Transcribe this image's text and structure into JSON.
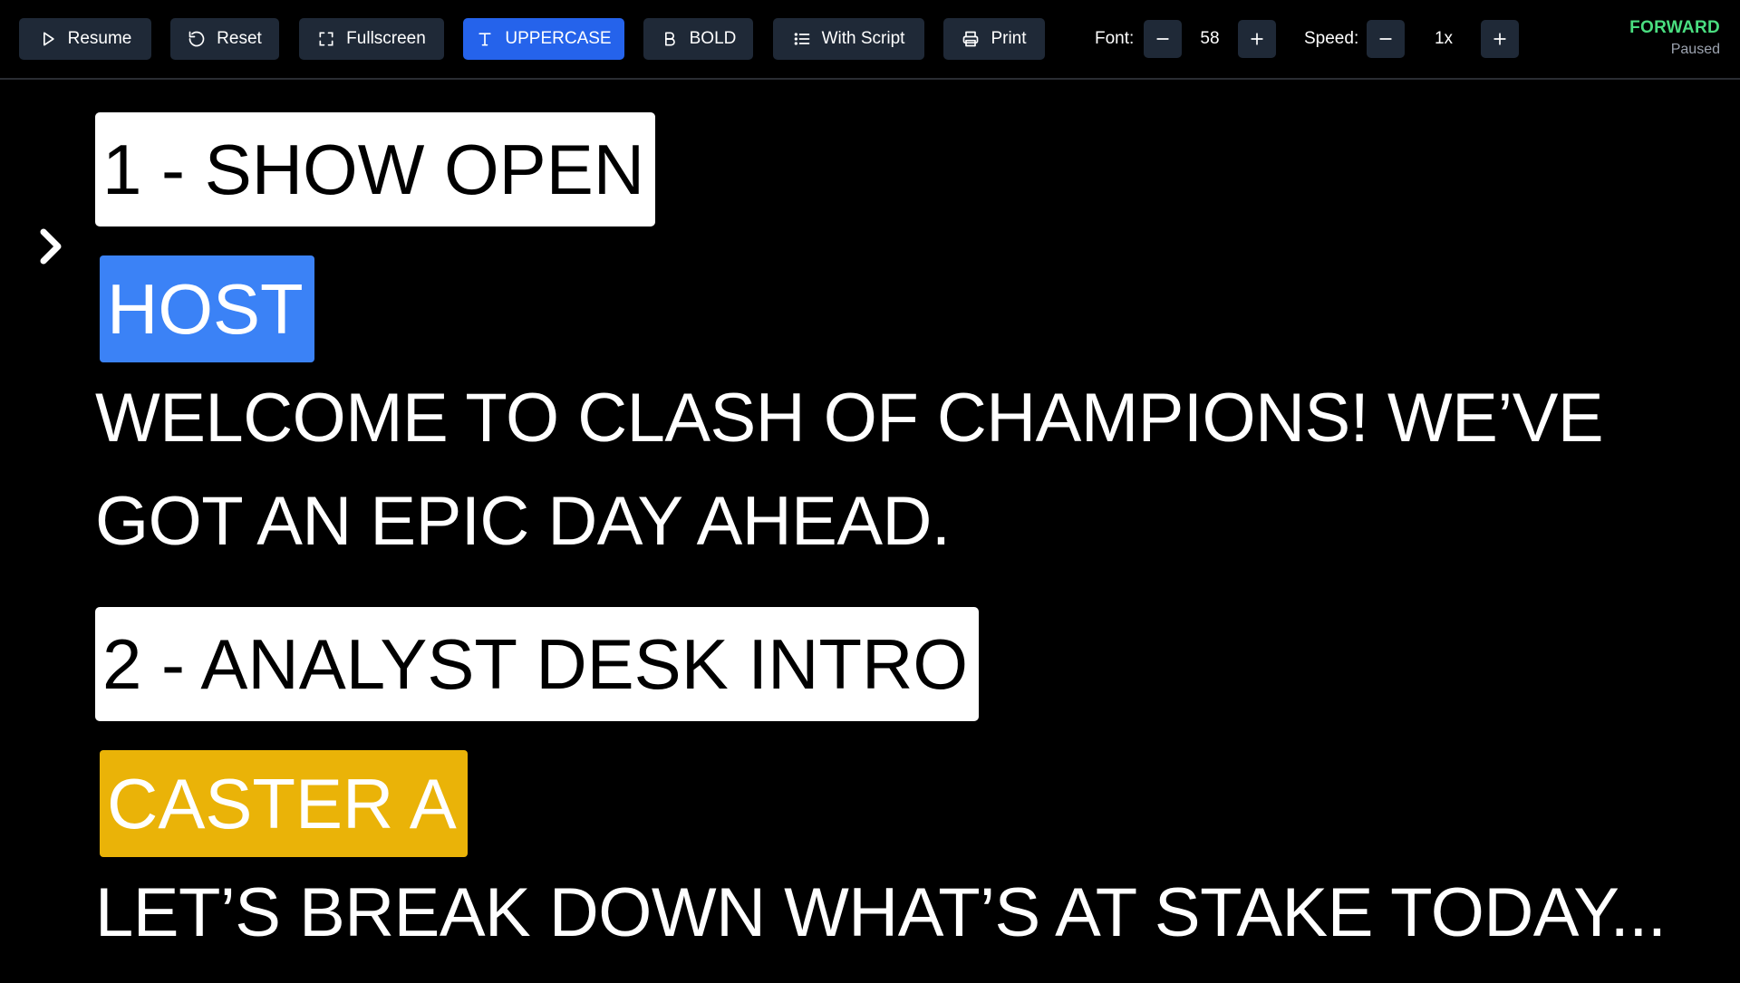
{
  "toolbar": {
    "resume_label": "Resume",
    "reset_label": "Reset",
    "fullscreen_label": "Fullscreen",
    "uppercase_label": "UPPERCASE",
    "bold_label": "BOLD",
    "with_script_label": "With Script",
    "print_label": "Print",
    "font_label": "Font:",
    "font_value": "58",
    "speed_label": "Speed:",
    "speed_value": "1x",
    "direction": "FORWARD",
    "state": "Paused",
    "active_color": "#2563eb",
    "direction_color": "#4ade80"
  },
  "script": {
    "segments": [
      {
        "title": "1 - SHOW OPEN",
        "speaker": "HOST",
        "speaker_color": "#3b82f6",
        "lines": [
          "WELCOME TO CLASH OF CHAMPIONS! WE’VE",
          "GOT AN EPIC DAY AHEAD."
        ]
      },
      {
        "title": "2 - ANALYST DESK INTRO",
        "speaker": "CASTER A",
        "speaker_color": "#eab308",
        "lines": [
          "LET’S BREAK DOWN WHAT’S AT STAKE TODAY..."
        ]
      }
    ],
    "pointer_icon": "chevron-right-icon"
  }
}
